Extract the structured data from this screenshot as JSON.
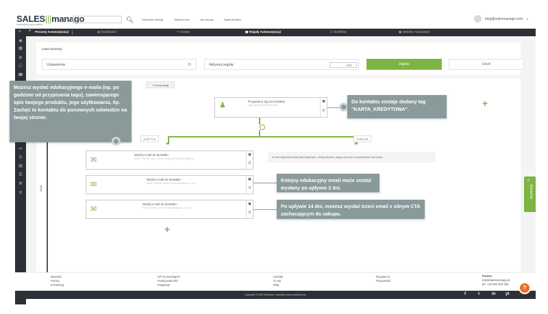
{
  "header": {
    "logo_main": "SALES",
    "logo_bars": "|||",
    "logo_end": "manago",
    "logo_sub": "marketing automation",
    "search_placeholder": "Szukaj...",
    "links": [
      "Instrukcje obsługi",
      "Społeczność",
      "Jak zacząć",
      "Zgłoś problem"
    ],
    "user_email": "blog@salesmanago.com"
  },
  "nav": {
    "section_title": "Procesy Automatyzacji",
    "tabs": [
      "Dashboard",
      "Kreator",
      "Reguły Automatyzacji",
      "Workflow",
      "Website Automation"
    ],
    "active_tab": "Reguły Automatyzacji"
  },
  "rule": {
    "name": "Lead nurturing",
    "settings_label": "Ustawienia",
    "activate_label": "Aktywuj regułę",
    "toggle_state": "OFF",
    "save_label": "Zapisz",
    "delete_label": "Usuń"
  },
  "canvas": {
    "add_action": "+ Dodaj akcję",
    "actions_label": "Akcje",
    "trigger_title": "Przypisano tag do kontaktu",
    "trigger_sub": "Tag: KARTA_KREDYTOWA",
    "branch_yes": "Jeśli TAK",
    "branch_no": "Jeśli NIE",
    "no_branch_msg": "W celu włączenia akcji alternatywnych, dodaj warunki i wyłącz ponowne sprawdzanie warunków.",
    "email_cards": [
      {
        "title": "Wyślij e-mail do kontaktu",
        "sub": "Email: KARTA_opis / Karta kredytowa Produkt / godzinie"
      },
      {
        "title": "Wyślij e-mail do kontaktu",
        "sub": "Email: KARTA_email / Karta kredytowa / 3 dni"
      },
      {
        "title": "Wyślij e-mail do kontaktu",
        "sub": "Email: KARTA_CTA / Karta kredytowa / 14 dni"
      }
    ],
    "elements_tab": "Elementy"
  },
  "callouts": {
    "left": "Możesz wysłać edukacyjnego e-maila (np. po godzinie od przypisania tagu), zawierającego opis twojego produktu, jego użytkowania, itp. Zachęć to kontaktu do ponownych odwiedzin na twojej stronie.",
    "trigger": "Do kontaktu zostaje dodany tag \"KARTA_KREDYTOWA\".",
    "email2": "Kolejny edukacyjny email może zostać wysłany po upływie 3 dni.",
    "email3": "Po upływie 14 dni, możesz wysłać trzeci email z silnym CTA zachęcającym do zakupu."
  },
  "footer": {
    "col1": [
      "Nowości",
      "Pomoc",
      "E-learning"
    ],
    "col2": [
      "API & Developers",
      "Funkcjonalności",
      "Integracje"
    ],
    "col3": [
      "Kontakt",
      "O nas",
      "Blog"
    ],
    "col4": [
      "Regulamin",
      "Prywatność"
    ],
    "support_title": "Pomoc:",
    "support_email": "bok@salesmanago.pl",
    "support_phone": "tel: +48 000 000 000",
    "copyright": "Copyright © 2020 Benhauer. Wszelkie prawa zastrzeżone.",
    "social": [
      "f",
      "t",
      "in",
      "yt"
    ]
  },
  "colors": {
    "accent": "#7db544",
    "dark": "#2d3137",
    "callout": "#8a9a9b"
  }
}
